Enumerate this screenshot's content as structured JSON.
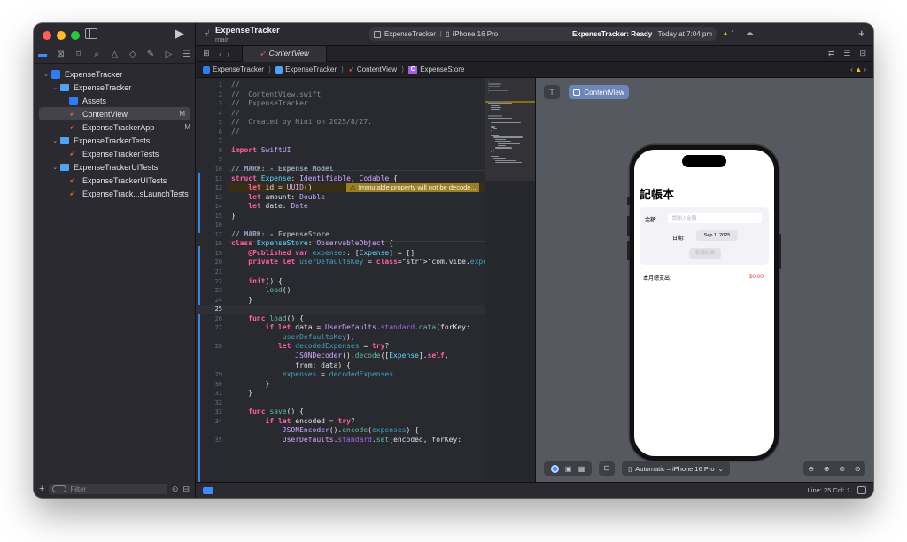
{
  "toolbar": {
    "project_title": "ExpenseTracker",
    "branch": "main",
    "scheme_target": "ExpenseTracker",
    "scheme_device": "iPhone 16 Pro",
    "status_app": "ExpenseTracker:",
    "status_state": "Ready",
    "status_time": "Today at 7:04 pm",
    "warning_count": "1"
  },
  "tab": {
    "label": "ContentView"
  },
  "breadcrumb": [
    "ExpenseTracker",
    "ExpenseTracker",
    "ContentView",
    "ExpenseStore"
  ],
  "navigator": {
    "filter_placeholder": "Filter",
    "items": [
      {
        "label": "ExpenseTracker",
        "kind": "project",
        "depth": 0,
        "badge": ""
      },
      {
        "label": "ExpenseTracker",
        "kind": "folder",
        "depth": 1,
        "badge": ""
      },
      {
        "label": "Assets",
        "kind": "assets",
        "depth": 2,
        "badge": ""
      },
      {
        "label": "ContentView",
        "kind": "swift",
        "depth": 2,
        "badge": "M"
      },
      {
        "label": "ExpenseTrackerApp",
        "kind": "swift",
        "depth": 2,
        "badge": "M"
      },
      {
        "label": "ExpenseTrackerTests",
        "kind": "folder",
        "depth": 1,
        "badge": ""
      },
      {
        "label": "ExpenseTrackerTests",
        "kind": "swift",
        "depth": 2,
        "badge": ""
      },
      {
        "label": "ExpenseTrackerUITests",
        "kind": "folder",
        "depth": 1,
        "badge": ""
      },
      {
        "label": "ExpenseTrackerUITests",
        "kind": "swift",
        "depth": 2,
        "badge": ""
      },
      {
        "label": "ExpenseTrack...sLaunchTests",
        "kind": "swift",
        "depth": 2,
        "badge": ""
      }
    ]
  },
  "editor": {
    "warning_text": "Immutable property will not be decode...",
    "lines": [
      {
        "n": "1",
        "t": "//"
      },
      {
        "n": "2",
        "t": "//  ContentView.swift"
      },
      {
        "n": "3",
        "t": "//  ExpenseTracker"
      },
      {
        "n": "4",
        "t": "//"
      },
      {
        "n": "5",
        "t": "//  Created by Nini on 2025/8/27."
      },
      {
        "n": "6",
        "t": "//"
      },
      {
        "n": "7",
        "t": ""
      },
      {
        "n": "8",
        "t": "import SwiftUI"
      },
      {
        "n": "9",
        "t": ""
      },
      {
        "n": "10",
        "t": "// MARK: - Expense Model"
      },
      {
        "n": "11",
        "t": "struct Expense: Identifiable, Codable {"
      },
      {
        "n": "12",
        "t": "    let id = UUID()"
      },
      {
        "n": "13",
        "t": "    let amount: Double"
      },
      {
        "n": "14",
        "t": "    let date: Date"
      },
      {
        "n": "15",
        "t": "}"
      },
      {
        "n": "16",
        "t": ""
      },
      {
        "n": "17",
        "t": "// MARK: - ExpenseStore"
      },
      {
        "n": "18",
        "t": "class ExpenseStore: ObservableObject {"
      },
      {
        "n": "19",
        "t": "    @Published var expenses: [Expense] = []"
      },
      {
        "n": "20",
        "t": "    private let userDefaultsKey = \"com.vibe.expenses\""
      },
      {
        "n": "21",
        "t": ""
      },
      {
        "n": "22",
        "t": "    init() {"
      },
      {
        "n": "23",
        "t": "        load()"
      },
      {
        "n": "24",
        "t": "    }"
      },
      {
        "n": "25",
        "t": ""
      },
      {
        "n": "26",
        "t": "    func load() {"
      },
      {
        "n": "27",
        "t": "        if let data = UserDefaults.standard.data(forKey:"
      },
      {
        "n": "",
        "t": "            userDefaultsKey),"
      },
      {
        "n": "28",
        "t": "           let decodedExpenses = try?"
      },
      {
        "n": "",
        "t": "               JSONDecoder().decode([Expense].self,"
      },
      {
        "n": "",
        "t": "               from: data) {"
      },
      {
        "n": "29",
        "t": "            expenses = decodedExpenses"
      },
      {
        "n": "30",
        "t": "        }"
      },
      {
        "n": "31",
        "t": "    }"
      },
      {
        "n": "32",
        "t": ""
      },
      {
        "n": "33",
        "t": "    func save() {"
      },
      {
        "n": "34",
        "t": "        if let encoded = try?"
      },
      {
        "n": "",
        "t": "            JSONEncoder().encode(expenses) {"
      },
      {
        "n": "35",
        "t": "            UserDefaults.standard.set(encoded, forKey:"
      }
    ]
  },
  "preview": {
    "chip_label": "ContentView",
    "app_title": "記帳本",
    "amount_label": "金額:",
    "amount_placeholder": "請輸入金額",
    "date_label": "日期:",
    "date_value": "Sep 1, 2025",
    "add_button": "新增紀錄",
    "total_label": "本月總支出:",
    "total_value": "$0.00",
    "device_selector": "Automatic – iPhone 16 Pro"
  },
  "statusbar": {
    "line_col": "Line: 25  Col: 1"
  },
  "colors": {
    "accent": "#3d8bff",
    "warning": "#f5c518",
    "total_red": "#ff3b30"
  }
}
